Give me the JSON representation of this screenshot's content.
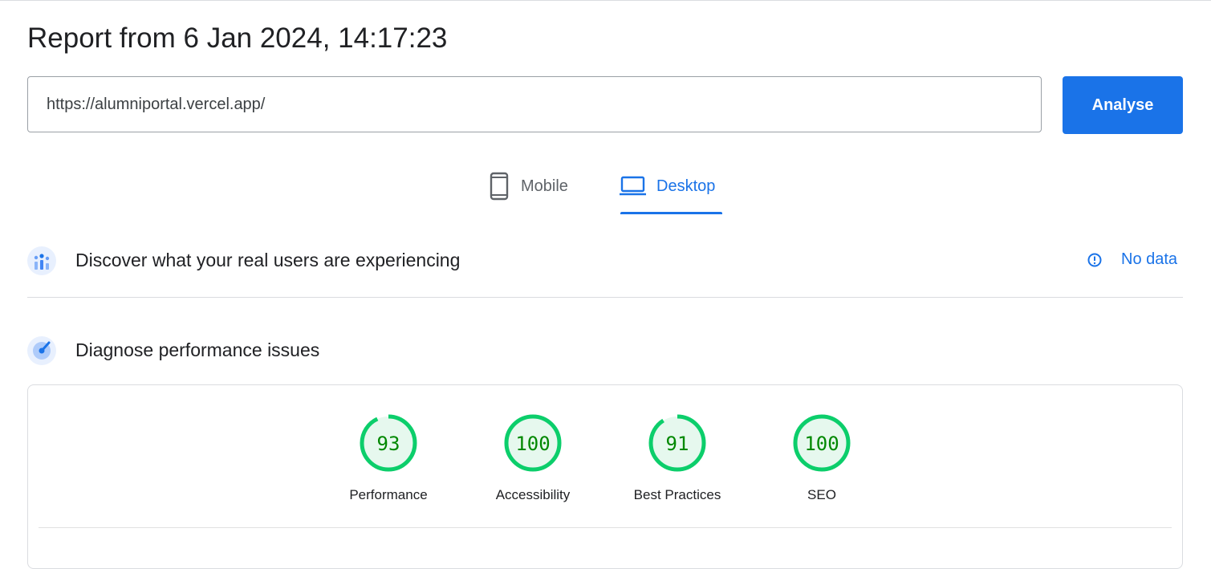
{
  "report": {
    "title": "Report from 6 Jan 2024, 14:17:23"
  },
  "url_input": {
    "value": "https://alumniportal.vercel.app/"
  },
  "analyse_button": {
    "label": "Analyse"
  },
  "tabs": [
    {
      "label": "Mobile",
      "icon": "phone-icon",
      "selected": false
    },
    {
      "label": "Desktop",
      "icon": "laptop-icon",
      "selected": true
    }
  ],
  "field_data": {
    "title": "Discover what your real users are experiencing",
    "status": "No data",
    "icon": "users-chart-icon",
    "status_icon": "info-icon"
  },
  "lab_data": {
    "title": "Diagnose performance issues",
    "icon": "gauge-icon"
  },
  "scores": [
    {
      "label": "Performance",
      "value": 93
    },
    {
      "label": "Accessibility",
      "value": 100
    },
    {
      "label": "Best Practices",
      "value": 91
    },
    {
      "label": "SEO",
      "value": 100
    }
  ],
  "colors": {
    "accent": "#1a73e8",
    "score_good": "#0cce6b",
    "score_good_text": "#008800",
    "score_good_fill": "#e6f8ee"
  }
}
